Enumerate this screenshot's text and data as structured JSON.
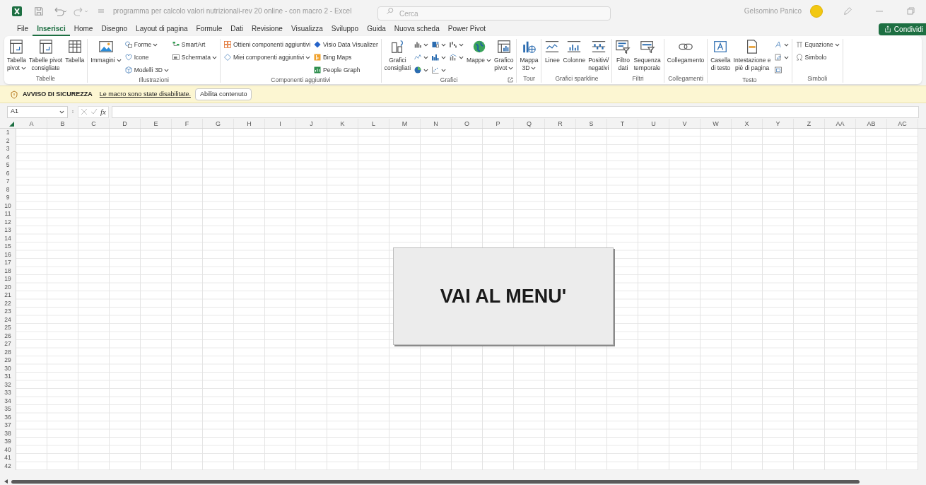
{
  "title_bar": {
    "title": "programma per calcolo valori nutrizionali-rev 20 online - con macro 2 - Excel",
    "search_placeholder": "Cerca",
    "user": "Gelsomino Panico"
  },
  "share_button": "Condividi",
  "tabs": [
    {
      "label": "File",
      "selected": false
    },
    {
      "label": "Inserisci",
      "selected": true
    },
    {
      "label": "Home",
      "selected": false
    },
    {
      "label": "Disegno",
      "selected": false
    },
    {
      "label": "Layout di pagina",
      "selected": false
    },
    {
      "label": "Formule",
      "selected": false
    },
    {
      "label": "Dati",
      "selected": false
    },
    {
      "label": "Revisione",
      "selected": false
    },
    {
      "label": "Visualizza",
      "selected": false
    },
    {
      "label": "Sviluppo",
      "selected": false
    },
    {
      "label": "Guida",
      "selected": false
    },
    {
      "label": "Nuova scheda",
      "selected": false
    },
    {
      "label": "Power Pivot",
      "selected": false
    }
  ],
  "ribbon": {
    "groups": [
      {
        "label": "Tabelle",
        "items": [
          {
            "kind": "large",
            "lines": [
              "Tabella",
              "pivot"
            ],
            "dropdown": true
          },
          {
            "kind": "large",
            "lines": [
              "Tabelle pivot",
              "consigliate"
            ],
            "dropdown": false
          },
          {
            "kind": "large",
            "lines": [
              "Tabella"
            ],
            "dropdown": false
          }
        ]
      },
      {
        "label": "Illustrazioni",
        "items": [
          {
            "kind": "large",
            "lines": [
              "Immagini"
            ],
            "dropdown": true
          },
          {
            "kind": "stack",
            "items": [
              {
                "label": "Forme",
                "dropdown": true
              },
              {
                "label": "Icone",
                "dropdown": false
              },
              {
                "label": "Modelli 3D",
                "dropdown": true
              }
            ]
          },
          {
            "kind": "stack",
            "items": [
              {
                "label": "SmartArt",
                "dropdown": false
              },
              {
                "label": "Schermata",
                "dropdown": true
              }
            ]
          }
        ]
      },
      {
        "label": "Componenti aggiuntivi",
        "items": [
          {
            "kind": "stack",
            "items": [
              {
                "label": "Ottieni componenti aggiuntivi",
                "dropdown": false
              },
              {
                "label": "Miei componenti aggiuntivi",
                "dropdown": true
              }
            ]
          },
          {
            "kind": "stack",
            "items": [
              {
                "label": "Visio Data Visualizer",
                "dropdown": false
              },
              {
                "label": "Bing Maps",
                "dropdown": false
              },
              {
                "label": "People Graph",
                "dropdown": false
              }
            ]
          }
        ]
      },
      {
        "label": "Grafici",
        "launcher": true,
        "items": [
          {
            "kind": "large",
            "lines": [
              "Grafici",
              "consigliati"
            ],
            "dropdown": false
          },
          {
            "kind": "stack",
            "items": [
              {
                "dropdown": true
              },
              {
                "dropdown": true
              },
              {
                "dropdown": true
              }
            ]
          },
          {
            "kind": "stack",
            "items": [
              {
                "dropdown": true
              },
              {
                "dropdown": true
              },
              {
                "dropdown": true
              }
            ]
          },
          {
            "kind": "stack",
            "items": [
              {
                "dropdown": true
              },
              {
                "dropdown": true
              }
            ]
          },
          {
            "kind": "large",
            "lines": [
              "Mappe"
            ],
            "dropdown": true
          },
          {
            "kind": "large",
            "lines": [
              "Grafico",
              "pivot"
            ],
            "dropdown": true
          }
        ]
      },
      {
        "label": "Tour",
        "items": [
          {
            "kind": "large",
            "lines": [
              "Mappa",
              "3D"
            ],
            "dropdown": true
          }
        ]
      },
      {
        "label": "Grafici sparkline",
        "items": [
          {
            "kind": "large",
            "lines": [
              "Linee"
            ],
            "dropdown": false
          },
          {
            "kind": "large",
            "lines": [
              "Colonne"
            ],
            "dropdown": false
          },
          {
            "kind": "large",
            "lines": [
              "Positivi/",
              "negativi"
            ],
            "dropdown": false
          }
        ]
      },
      {
        "label": "Filtri",
        "items": [
          {
            "kind": "large",
            "lines": [
              "Filtro",
              "dati"
            ],
            "dropdown": false
          },
          {
            "kind": "large",
            "lines": [
              "Sequenza",
              "temporale"
            ],
            "dropdown": false
          }
        ]
      },
      {
        "label": "Collegamenti",
        "items": [
          {
            "kind": "large",
            "lines": [
              "Collegamento"
            ],
            "dropdown": false
          }
        ]
      },
      {
        "label": "Testo",
        "items": [
          {
            "kind": "large",
            "lines": [
              "Casella",
              "di testo"
            ],
            "dropdown": false
          },
          {
            "kind": "large",
            "lines": [
              "Intestazione e",
              "piè di pagina"
            ],
            "dropdown": false
          },
          {
            "kind": "stack",
            "items": [
              {
                "dropdown": true
              },
              {
                "dropdown": true
              },
              {
                "dropdown": false
              }
            ]
          }
        ]
      },
      {
        "label": "Simboli",
        "items": [
          {
            "kind": "stack",
            "items": [
              {
                "label": "Equazione",
                "dropdown": true
              },
              {
                "label": "Simbolo",
                "dropdown": false
              }
            ]
          }
        ]
      }
    ]
  },
  "security_bar": {
    "title": "AVVISO DI SICUREZZA",
    "message": "Le macro sono state disabilitate.",
    "button": "Abilita contenuto"
  },
  "formula_bar": {
    "name_box": "A1",
    "function_label": "fx"
  },
  "sheet": {
    "columns": [
      "A",
      "B",
      "C",
      "D",
      "E",
      "F",
      "G",
      "H",
      "I",
      "J",
      "K",
      "L",
      "M",
      "N",
      "O",
      "P",
      "Q",
      "R",
      "S",
      "T",
      "U",
      "V",
      "W",
      "X",
      "Y",
      "Z",
      "AA",
      "AB",
      "AC"
    ],
    "rows": [
      "1",
      "2",
      "3",
      "4",
      "5",
      "6",
      "7",
      "8",
      "9",
      "10",
      "11",
      "12",
      "13",
      "14",
      "15",
      "16",
      "17",
      "18",
      "19",
      "20",
      "21",
      "22",
      "23",
      "24",
      "25",
      "26",
      "27",
      "28",
      "29",
      "30",
      "31",
      "32",
      "33",
      "34",
      "35",
      "36",
      "37",
      "38",
      "39",
      "40",
      "41",
      "42"
    ]
  },
  "macro_button": {
    "label": "VAI AL MENU'"
  }
}
